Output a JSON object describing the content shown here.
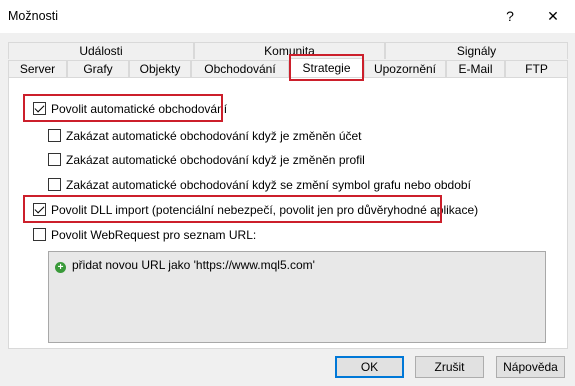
{
  "window": {
    "title": "Možnosti",
    "help_glyph": "?",
    "close_glyph": "✕"
  },
  "tabs": {
    "top": [
      "Události",
      "Komunita",
      "Signály"
    ],
    "bottom": [
      "Server",
      "Grafy",
      "Objekty",
      "Obchodování",
      "Strategie",
      "Upozornění",
      "E-Mail",
      "FTP"
    ],
    "active": "Strategie"
  },
  "options": {
    "allow_auto_trading": {
      "label": "Povolit automatické obchodování",
      "checked": true
    },
    "disable_on_account_change": {
      "label": "Zakázat automatické obchodování když je změněn účet",
      "checked": false
    },
    "disable_on_profile_change": {
      "label": "Zakázat automatické obchodování když je změněn profil",
      "checked": false
    },
    "disable_on_symbol_change": {
      "label": "Zakázat automatické obchodování když se změní symbol grafu nebo období",
      "checked": false
    },
    "allow_dll_import": {
      "label": "Povolit DLL import (potenciální nebezpečí, povolit jen pro důvěryhodné aplikace)",
      "checked": true
    },
    "allow_webrequest": {
      "label": "Povolit WebRequest pro seznam URL:",
      "checked": false
    }
  },
  "url_list": {
    "add_item": "přidat novou URL jako 'https://www.mql5.com'"
  },
  "buttons": {
    "ok": "OK",
    "cancel": "Zrušit",
    "help": "Nápověda"
  }
}
